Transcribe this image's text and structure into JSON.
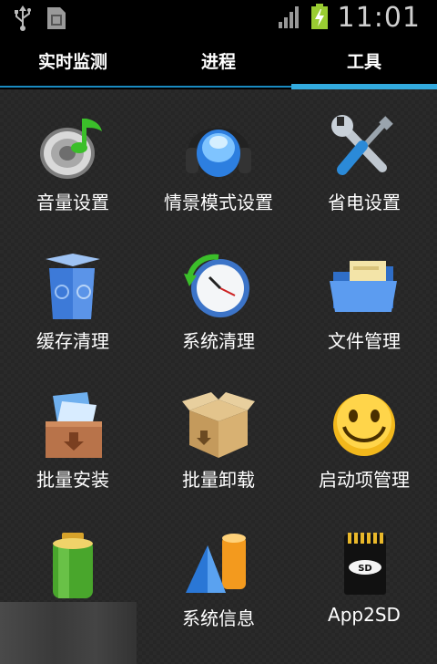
{
  "status_bar": {
    "time": "11:01",
    "icons": [
      "usb-icon",
      "sim-card-icon",
      "signal-icon",
      "battery-charging-icon"
    ]
  },
  "tabs": [
    {
      "label": "实时监测",
      "selected": false
    },
    {
      "label": "进程",
      "selected": false
    },
    {
      "label": "工具",
      "selected": true
    }
  ],
  "colors": {
    "accent": "#33aade",
    "background": "#2a2a2a",
    "tabbar": "#000000"
  },
  "tools": [
    {
      "label": "音量设置",
      "icon": "volume-speaker-icon"
    },
    {
      "label": "情景模式设置",
      "icon": "headphones-icon"
    },
    {
      "label": "省电设置",
      "icon": "wrench-screwdriver-icon"
    },
    {
      "label": "缓存清理",
      "icon": "recycle-bin-icon"
    },
    {
      "label": "系统清理",
      "icon": "clock-refresh-icon"
    },
    {
      "label": "文件管理",
      "icon": "folder-icon"
    },
    {
      "label": "批量安装",
      "icon": "install-box-icon"
    },
    {
      "label": "批量卸载",
      "icon": "uninstall-box-icon"
    },
    {
      "label": "启动项管理",
      "icon": "smiley-icon"
    },
    {
      "label": "",
      "icon": "battery-icon"
    },
    {
      "label": "系统信息",
      "icon": "shapes-icon"
    },
    {
      "label": "App2SD",
      "icon": "sd-card-icon"
    }
  ]
}
